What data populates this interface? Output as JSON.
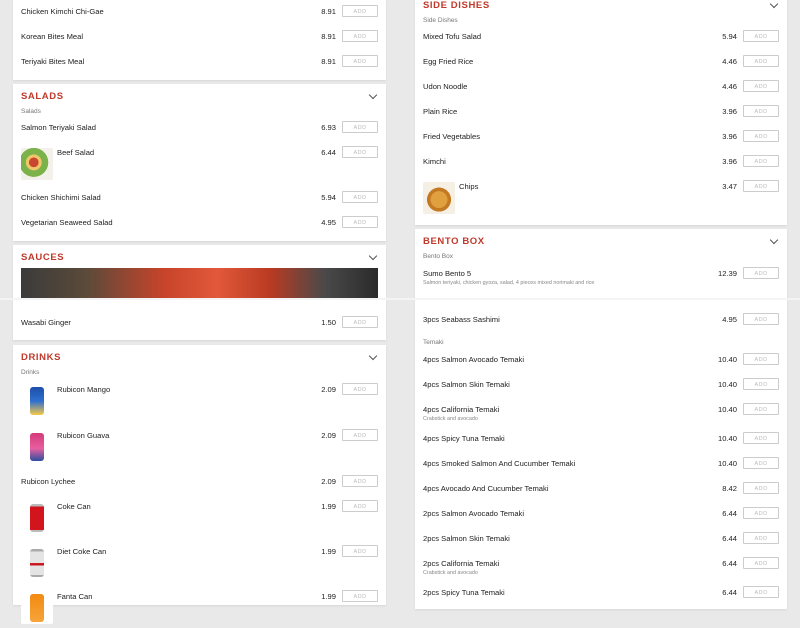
{
  "left": {
    "top_items": [
      {
        "name": "Chicken Kimchi Chi-Gae",
        "price": "8.91",
        "add": "ADD"
      },
      {
        "name": "Korean Bites Meal",
        "price": "8.91",
        "add": "ADD"
      },
      {
        "name": "Teriyaki Bites Meal",
        "price": "8.91",
        "add": "ADD"
      }
    ],
    "salads": {
      "title": "SALADS",
      "subtitle": "Salads",
      "items": [
        {
          "name": "Salmon Teriyaki Salad",
          "price": "6.93",
          "add": "ADD"
        },
        {
          "name": "Beef Salad",
          "price": "6.44",
          "add": "ADD"
        },
        {
          "name": "Chicken Shichimi Salad",
          "price": "5.94",
          "add": "ADD"
        },
        {
          "name": "Vegetarian Seaweed Salad",
          "price": "4.95",
          "add": "ADD"
        }
      ]
    },
    "sauces": {
      "title": "SAUCES",
      "items": [
        {
          "name": "Wasabi Ginger",
          "price": "1.50",
          "add": "ADD"
        }
      ]
    },
    "drinks": {
      "title": "DRINKS",
      "subtitle": "Drinks",
      "items": [
        {
          "name": "Rubicon Mango",
          "price": "2.09",
          "add": "ADD"
        },
        {
          "name": "Rubicon Guava",
          "price": "2.09",
          "add": "ADD"
        },
        {
          "name": "Rubicon Lychee",
          "price": "2.09",
          "add": "ADD"
        },
        {
          "name": "Coke Can",
          "price": "1.99",
          "add": "ADD"
        },
        {
          "name": "Diet Coke Can",
          "price": "1.99",
          "add": "ADD"
        },
        {
          "name": "Fanta Can",
          "price": "1.99",
          "add": "ADD"
        }
      ]
    }
  },
  "right": {
    "side_dishes": {
      "title": "SIDE DISHES",
      "subtitle": "Side Dishes",
      "items": [
        {
          "name": "Mixed Tofu Salad",
          "price": "5.94",
          "add": "ADD"
        },
        {
          "name": "Egg Fried Rice",
          "price": "4.46",
          "add": "ADD"
        },
        {
          "name": "Udon Noodle",
          "price": "4.46",
          "add": "ADD"
        },
        {
          "name": "Plain Rice",
          "price": "3.96",
          "add": "ADD"
        },
        {
          "name": "Fried Vegetables",
          "price": "3.96",
          "add": "ADD"
        },
        {
          "name": "Kimchi",
          "price": "3.96",
          "add": "ADD"
        },
        {
          "name": "Chips",
          "price": "3.47",
          "add": "ADD"
        }
      ]
    },
    "bento_box": {
      "title": "BENTO BOX",
      "subtitle": "Bento Box",
      "items": [
        {
          "name": "Sumo Bento 5",
          "desc": "Salmon teriyaki, chicken gyoza, salad, 4 pieces mixed norimaki and rice",
          "price": "12.39",
          "add": "ADD"
        },
        {
          "name": "3pcs Seabass Sashimi",
          "price": "4.95",
          "add": "ADD"
        }
      ]
    },
    "temaki": {
      "subtitle": "Temaki",
      "items": [
        {
          "name": "4pcs Salmon Avocado Temaki",
          "price": "10.40",
          "add": "ADD"
        },
        {
          "name": "4pcs Salmon Skin Temaki",
          "price": "10.40",
          "add": "ADD"
        },
        {
          "name": "4pcs California Temaki",
          "desc": "Crabstick and avocado",
          "price": "10.40",
          "add": "ADD"
        },
        {
          "name": "4pcs Spicy Tuna Temaki",
          "price": "10.40",
          "add": "ADD"
        },
        {
          "name": "4pcs Smoked Salmon And Cucumber Temaki",
          "price": "10.40",
          "add": "ADD"
        },
        {
          "name": "4pcs Avocado And Cucumber Temaki",
          "price": "8.42",
          "add": "ADD"
        },
        {
          "name": "2pcs Salmon Avocado Temaki",
          "price": "6.44",
          "add": "ADD"
        },
        {
          "name": "2pcs Salmon Skin Temaki",
          "price": "6.44",
          "add": "ADD"
        },
        {
          "name": "2pcs California Temaki",
          "desc": "Crabstick and avocado",
          "price": "6.44",
          "add": "ADD"
        },
        {
          "name": "2pcs Spicy Tuna Temaki",
          "price": "6.44",
          "add": "ADD"
        }
      ]
    }
  },
  "colors": {
    "accent": "#c0392b"
  }
}
